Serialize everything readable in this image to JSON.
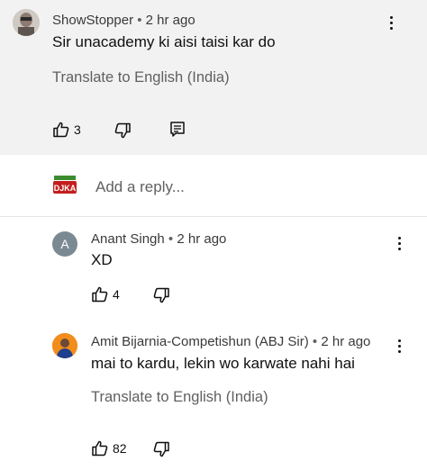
{
  "top_comment": {
    "author": "ShowStopper",
    "time": "2 hr ago",
    "text": "Sir unacademy ki aisi taisi kar do",
    "translate": "Translate to English (India)",
    "likes": "3"
  },
  "reply_box": {
    "placeholder": "Add a reply...",
    "avatar_text": "DJKA"
  },
  "replies": [
    {
      "author": "Anant Singh",
      "time": "2 hr ago",
      "text": "XD",
      "likes": "4",
      "avatar_letter": "A"
    },
    {
      "author": "Amit Bijarnia-Competishun (ABJ Sir)",
      "time": "2 hr ago",
      "text": "mai to kardu, lekin wo karwate nahi hai",
      "translate": "Translate to English (India)",
      "likes": "82"
    }
  ],
  "separator": "•",
  "colors": {
    "highlight_bg": "#f2f2f2",
    "text": "#0f0f0f",
    "muted": "#606060",
    "avatar_grey": "#7b8a92",
    "avatar_orange": "#f28c1b"
  }
}
